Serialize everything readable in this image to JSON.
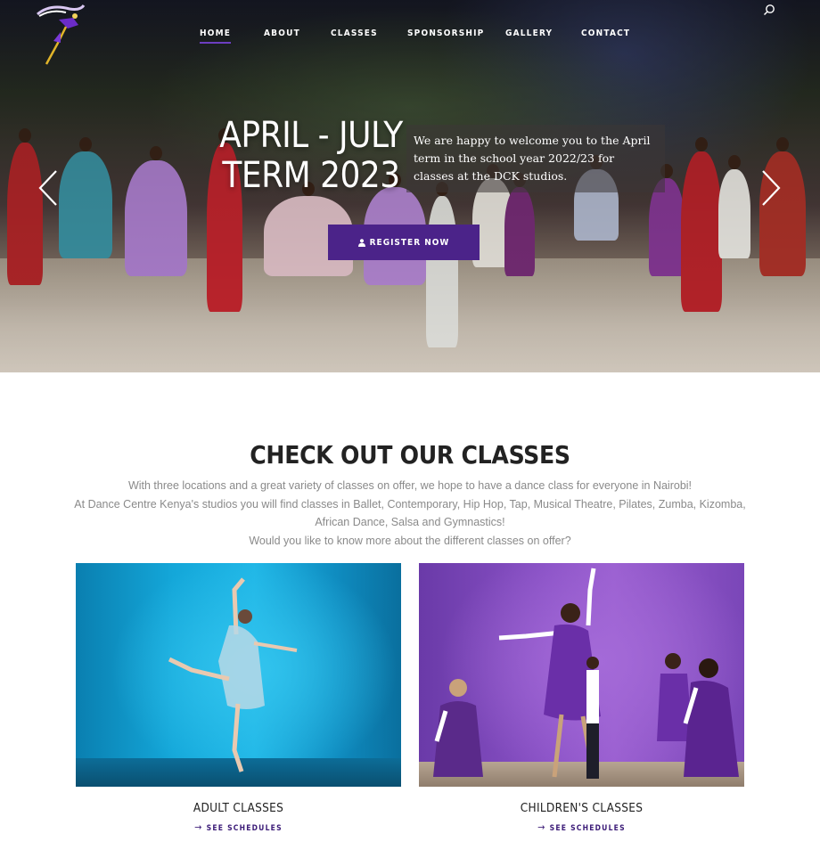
{
  "nav": {
    "items": [
      "HOME",
      "ABOUT",
      "CLASSES",
      "SPONSORSHIP",
      "GALLERY",
      "CONTACT"
    ],
    "active_index": 0
  },
  "hero": {
    "title_line1": "APRIL - JULY",
    "title_line2": "TERM 2023",
    "text": "We are happy to welcome you to the April term in the school year 2022/23 for classes at the DCK studios.",
    "button_label": "REGISTER NOW"
  },
  "classes_section": {
    "title_light": "CHECK OUT OUR ",
    "title_bold": "CLASSES",
    "description": [
      "With three locations and a great variety of classes on offer, we hope to have a dance class for everyone in Nairobi!",
      "At Dance Centre Kenya's studios you will find classes in Ballet, Contemporary, Hip Hop, Tap, Musical Theatre, Pilates, Zumba, Kizomba,",
      "African Dance, Salsa and Gymnastics!",
      "Would you like to know more about the different classes on offer?"
    ],
    "cards": [
      {
        "title": "ADULT CLASSES",
        "link_label": "SEE SCHEDULES"
      },
      {
        "title": "CHILDREN'S CLASSES",
        "link_label": "SEE SCHEDULES"
      }
    ]
  },
  "colors": {
    "accent": "#4b2389",
    "nav_underline": "#6c3ec1",
    "link": "#3c1c78"
  },
  "icons": [
    "logo-icon",
    "search-icon",
    "user-icon",
    "chevron-left-icon",
    "chevron-right-icon",
    "arrow-right-icon"
  ]
}
